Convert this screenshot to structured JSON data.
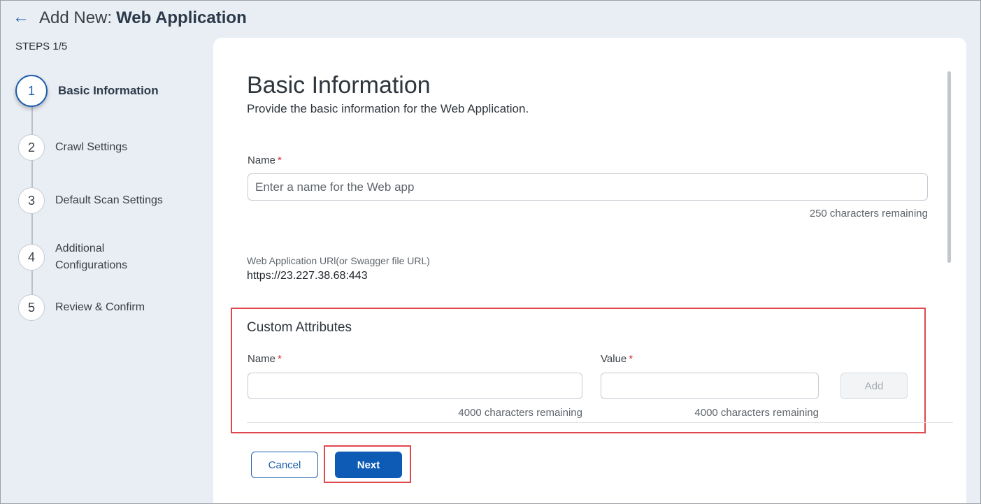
{
  "header": {
    "back_icon": "arrow-left-icon",
    "title_prefix": "Add New:",
    "title_bold": "Web Application",
    "steps_count": "STEPS 1/5"
  },
  "steps": [
    {
      "number": "1",
      "label": "Basic Information",
      "active": true
    },
    {
      "number": "2",
      "label": "Crawl Settings",
      "active": false
    },
    {
      "number": "3",
      "label": "Default Scan Settings",
      "active": false
    },
    {
      "number": "4",
      "label": "Additional Configurations",
      "active": false
    },
    {
      "number": "5",
      "label": "Review & Confirm",
      "active": false
    }
  ],
  "section": {
    "title": "Basic Information",
    "subtitle": "Provide the basic information for the Web Application."
  },
  "name_field": {
    "label": "Name",
    "required_mark": "*",
    "placeholder": "Enter a name for the Web app",
    "value": "",
    "hint": "250 characters remaining"
  },
  "url": {
    "label": "Web Application URl(or Swagger file URL)",
    "value": "https://23.227.38.68:443"
  },
  "custom_attributes": {
    "title": "Custom Attributes",
    "name_label": "Name",
    "value_label": "Value",
    "required_mark": "*",
    "name_hint": "4000 characters remaining",
    "value_hint": "4000 characters remaining",
    "add_label": "Add"
  },
  "footer": {
    "cancel_label": "Cancel",
    "next_label": "Next"
  },
  "colors": {
    "accent": "#0d5bb5",
    "highlight": "#e0484d",
    "required": "#d32f2f"
  }
}
